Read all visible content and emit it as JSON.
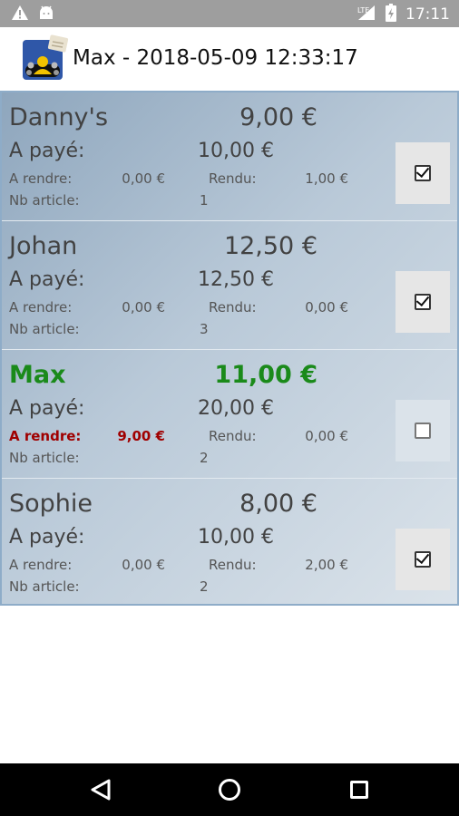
{
  "status": {
    "time": "17:11",
    "network": "LTE"
  },
  "app": {
    "title": "Max - 2018-05-09 12:33:17",
    "icon": "group-people-icon"
  },
  "labels": {
    "paid": "A payé:",
    "to_return": "A rendre:",
    "returned": "Rendu:",
    "nb_article": "Nb article:"
  },
  "entries": [
    {
      "name": "Danny's",
      "total": "9,00 €",
      "paid": "10,00 €",
      "to_return": "0,00 €",
      "returned": "1,00 €",
      "nb_article": "1",
      "checked": true,
      "active": false
    },
    {
      "name": "Johan",
      "total": "12,50 €",
      "paid": "12,50 €",
      "to_return": "0,00 €",
      "returned": "0,00 €",
      "nb_article": "3",
      "checked": true,
      "active": false
    },
    {
      "name": "Max",
      "total": "11,00 €",
      "paid": "20,00 €",
      "to_return": "9,00 €",
      "returned": "0,00 €",
      "nb_article": "2",
      "checked": false,
      "active": true
    },
    {
      "name": "Sophie",
      "total": "8,00 €",
      "paid": "10,00 €",
      "to_return": "0,00 €",
      "returned": "2,00 €",
      "nb_article": "2",
      "checked": true,
      "active": false
    }
  ],
  "colors": {
    "active_name": "#1a8a1a",
    "active_to_return": "#a00000"
  }
}
